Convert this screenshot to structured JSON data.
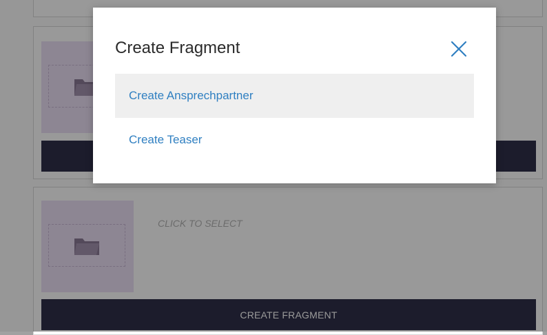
{
  "modal": {
    "title": "Create Fragment",
    "close_icon": "close-icon",
    "items": [
      {
        "label": "Create Ansprechpartner"
      },
      {
        "label": "Create Teaser"
      }
    ]
  },
  "cards": [
    {
      "select_label": "",
      "button_label": ""
    },
    {
      "select_label": "CLICK TO SELECT",
      "button_label": "CREATE FRAGMENT"
    }
  ],
  "colors": {
    "accent_link": "#2f7fc1",
    "bar": "#2f2f4a",
    "thumb": "#ecdff5",
    "overlay": "rgba(0,0,0,0.40)"
  }
}
